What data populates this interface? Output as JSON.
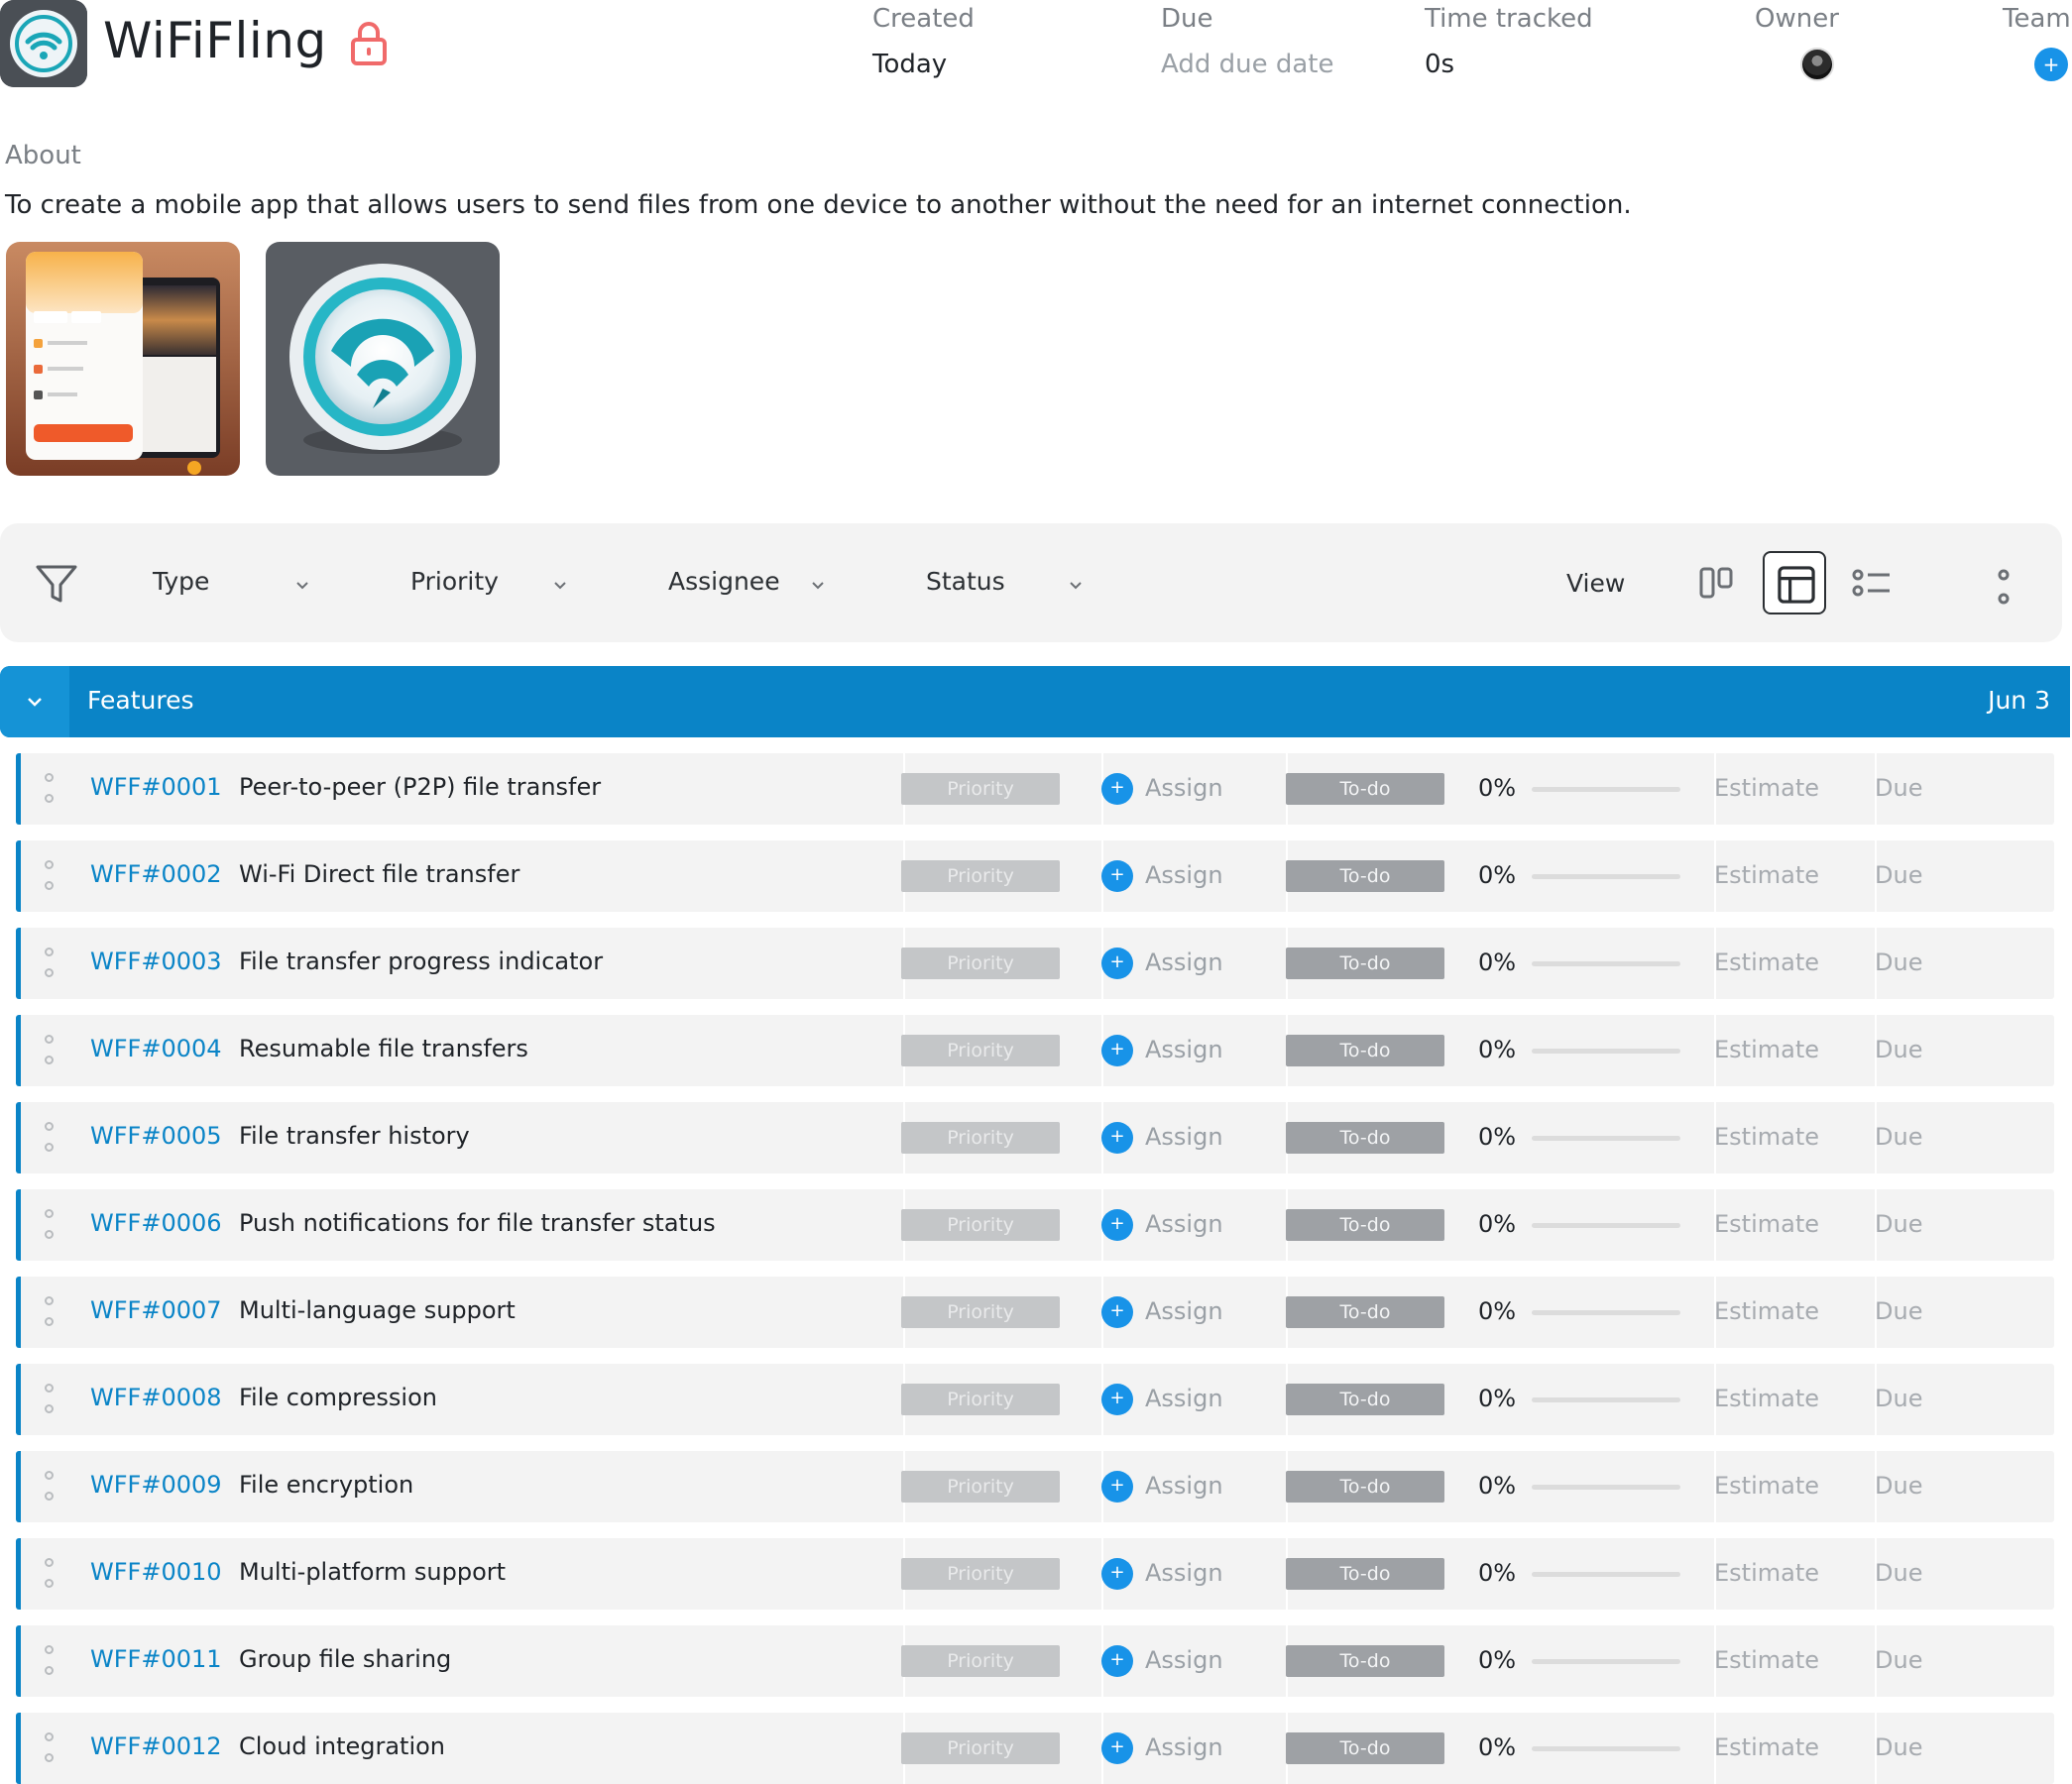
{
  "header": {
    "app_title": "WiFiFling",
    "icons": {
      "app": "wifi-app-icon",
      "lock": "lock-icon"
    },
    "lock_color": "#f06a6a",
    "meta": {
      "created_label": "Created",
      "created_value": "Today",
      "due_label": "Due",
      "due_value": "Add due date",
      "time_label": "Time tracked",
      "time_value": "0s",
      "owner_label": "Owner",
      "team_label": "Team",
      "team_add": "+"
    }
  },
  "about": {
    "label": "About",
    "text": "To create a mobile app that allows users to send files from one device to another without the need for an internet connection."
  },
  "filters": {
    "items": [
      {
        "label": "Type"
      },
      {
        "label": "Priority"
      },
      {
        "label": "Assignee"
      },
      {
        "label": "Status"
      }
    ],
    "view_label": "View",
    "views": [
      "board-view-icon",
      "table-view-icon",
      "list-view-icon"
    ],
    "active_view": "table-view-icon"
  },
  "group": {
    "title": "Features",
    "date": "Jun 3",
    "color": "#0a84c7"
  },
  "row_labels": {
    "priority": "Priority",
    "assign": "Assign",
    "assign_add": "+",
    "status": "To-do",
    "estimate": "Estimate",
    "due": "Due"
  },
  "tasks": [
    {
      "id": "WFF#0001",
      "title": "Peer-to-peer (P2P) file transfer",
      "progress": "0%"
    },
    {
      "id": "WFF#0002",
      "title": "Wi-Fi Direct file transfer",
      "progress": "0%"
    },
    {
      "id": "WFF#0003",
      "title": "File transfer progress indicator",
      "progress": "0%"
    },
    {
      "id": "WFF#0004",
      "title": "Resumable file transfers",
      "progress": "0%"
    },
    {
      "id": "WFF#0005",
      "title": "File transfer history",
      "progress": "0%"
    },
    {
      "id": "WFF#0006",
      "title": "Push notifications for file transfer status",
      "progress": "0%"
    },
    {
      "id": "WFF#0007",
      "title": "Multi-language support",
      "progress": "0%"
    },
    {
      "id": "WFF#0008",
      "title": "File compression",
      "progress": "0%"
    },
    {
      "id": "WFF#0009",
      "title": "File encryption",
      "progress": "0%"
    },
    {
      "id": "WFF#0010",
      "title": "Multi-platform support",
      "progress": "0%"
    },
    {
      "id": "WFF#0011",
      "title": "Group file sharing",
      "progress": "0%"
    },
    {
      "id": "WFF#0012",
      "title": "Cloud integration",
      "progress": "0%"
    }
  ]
}
